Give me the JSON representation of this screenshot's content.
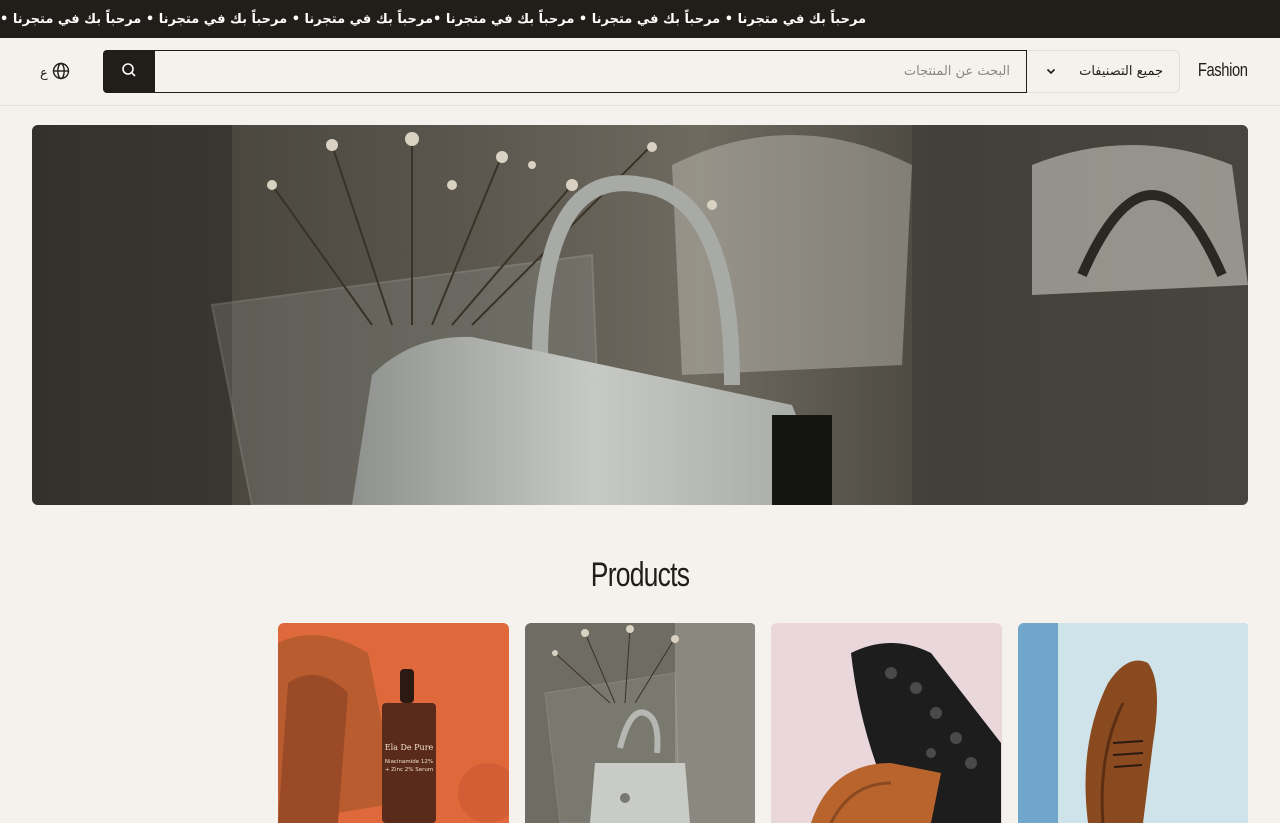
{
  "announcement": {
    "text": "مرحباً بك في متجرنا • مرحباً بك في متجرنا • مرحباً بك في متجرنا •مرحباً بك في متجرنا • مرحباً بك في متجرنا • مرحباً بك في متجرنا •"
  },
  "header": {
    "brand": "Fashion",
    "category_select": {
      "label": "جميع التصنيفات",
      "icon": "chevron-down-icon"
    },
    "search": {
      "placeholder": "البحث عن المنتجات",
      "value": "",
      "button_icon": "search-icon"
    },
    "language": {
      "label": "ع",
      "icon": "globe-icon"
    }
  },
  "hero": {
    "image": "handbag-with-dried-flowers"
  },
  "products_section": {
    "title": "Products",
    "items": [
      {
        "image": "serum-bottle-orange",
        "bottle_brand": "Ela De Pure",
        "bottle_line1": "Niacinamide 12%",
        "bottle_line2": "+ Zinc 2% Serum"
      },
      {
        "image": "white-handbag-flowers"
      },
      {
        "image": "black-brown-shoes"
      },
      {
        "image": "brown-leather-shoe"
      }
    ]
  },
  "colors": {
    "dark": "#211d18",
    "background": "#f5f2ed",
    "border": "#e3ded6"
  }
}
